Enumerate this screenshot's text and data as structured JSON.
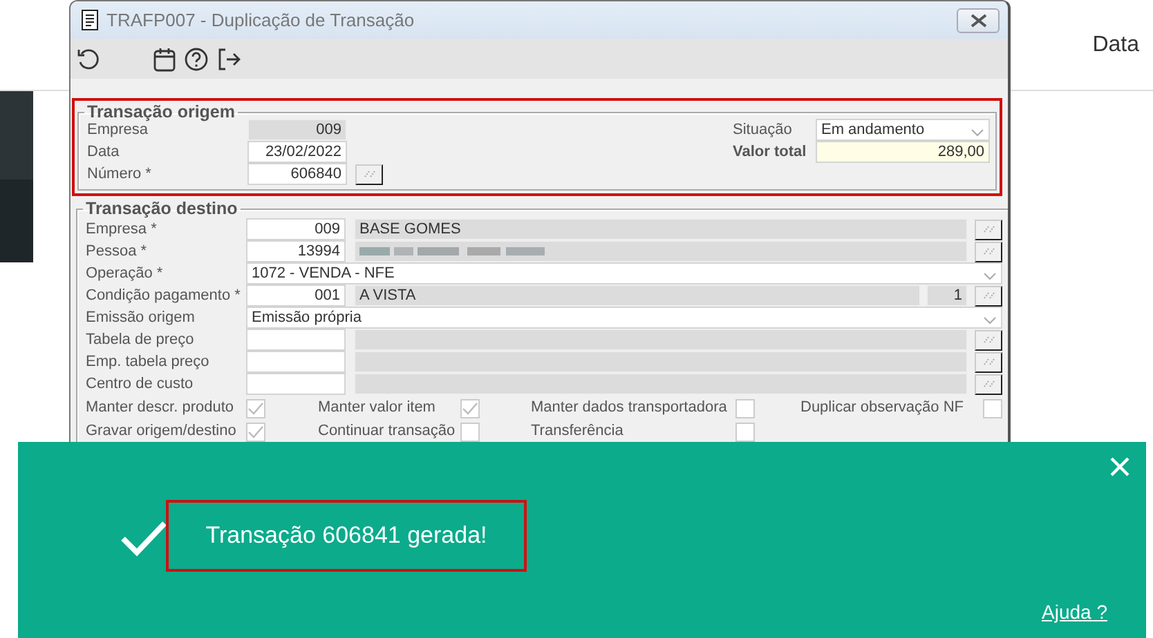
{
  "background": {
    "header": "Data"
  },
  "window": {
    "title": "TRAFP007 - Duplicação de Transação"
  },
  "origin": {
    "title": "Transação origem",
    "fields": [
      {
        "label": "Empresa",
        "value": "009",
        "readonly": true,
        "lookup": false
      },
      {
        "label": "Data",
        "value": "23/02/2022",
        "readonly": false,
        "lookup": false
      },
      {
        "label": "Número *",
        "value": "606840",
        "readonly": false,
        "lookup": true
      }
    ],
    "situacao": {
      "label": "Situação",
      "value": "Em andamento"
    },
    "total": {
      "label": "Valor total",
      "value": "289,00"
    }
  },
  "destination": {
    "title": "Transação destino",
    "rows": [
      {
        "kind": "lookup",
        "label": "Empresa *",
        "code": "009",
        "description": "BASE GOMES",
        "redacted": false
      },
      {
        "kind": "lookup",
        "label": "Pessoa *",
        "code": "13994",
        "redacted": true
      },
      {
        "kind": "select",
        "label": "Operação *",
        "value": "1072 - VENDA - NFE"
      },
      {
        "kind": "lookup_count",
        "label": "Condição pagamento *",
        "code": "001",
        "description": "A VISTA",
        "count": "1"
      },
      {
        "kind": "select",
        "label": "Emissão origem",
        "value": "Emissão própria"
      },
      {
        "kind": "lookup",
        "label": "Tabela de preço",
        "redacted": false
      },
      {
        "kind": "lookup",
        "label": "Emp. tabela preço",
        "redacted": false
      },
      {
        "kind": "lookup",
        "label": "Centro de custo",
        "redacted": false
      }
    ],
    "options": [
      {
        "label": "Manter descr. produto",
        "checked": true
      },
      {
        "label": "Manter valor item",
        "checked": true
      },
      {
        "label": "Manter dados transportadora",
        "checked": false
      },
      {
        "label": "Duplicar observação NF",
        "checked": false
      },
      {
        "label": "Gravar origem/destino",
        "checked": true
      },
      {
        "label": "Continuar transação",
        "checked": false
      },
      {
        "label": "Transferência",
        "checked": false
      }
    ]
  },
  "toast": {
    "message": "Transação 606841 gerada!",
    "help_link": "Ajuda ?"
  }
}
